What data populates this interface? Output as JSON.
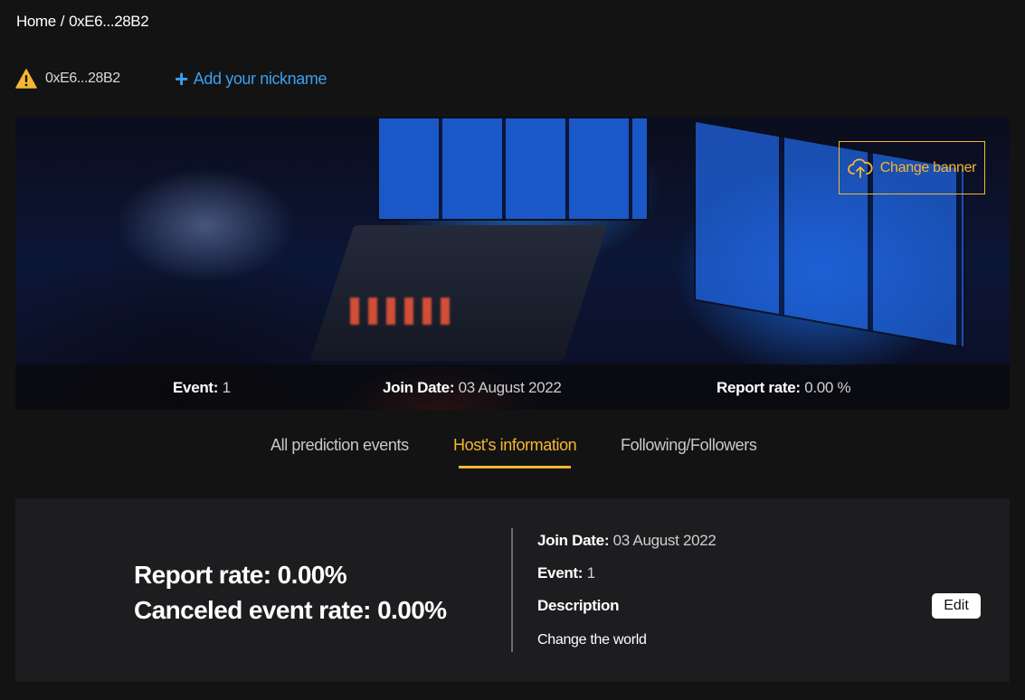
{
  "breadcrumb": {
    "home": "Home",
    "separator": "/",
    "current": "0xE6...28B2"
  },
  "profile": {
    "address": "0xE6...28B2",
    "warning_icon": "warning-triangle-icon",
    "add_nickname_label": "Add your nickname",
    "add_nickname_icon": "plus-icon"
  },
  "banner": {
    "change_banner_label": "Change banner",
    "change_banner_icon": "cloud-upload-icon",
    "stats": {
      "event_label": "Event:",
      "event_value": "1",
      "join_date_label": "Join Date:",
      "join_date_value": "03 August 2022",
      "report_rate_label": "Report rate:",
      "report_rate_value": "0.00 %"
    }
  },
  "tabs": [
    {
      "label": "All prediction events",
      "active": false
    },
    {
      "label": "Host's information",
      "active": true
    },
    {
      "label": "Following/Followers",
      "active": false
    }
  ],
  "host_info": {
    "report_rate": "Report rate: 0.00%",
    "canceled_event_rate": "Canceled event rate: 0.00%",
    "join_date_label": "Join Date:",
    "join_date_value": "03 August 2022",
    "event_label": "Event:",
    "event_value": "1",
    "description_label": "Description",
    "description_value": "Change the world",
    "edit_label": "Edit"
  },
  "colors": {
    "background": "#131313",
    "panel": "#1d1d20",
    "accent": "#f5b731",
    "link": "#3aa0f0",
    "warning": "#f5b731"
  }
}
